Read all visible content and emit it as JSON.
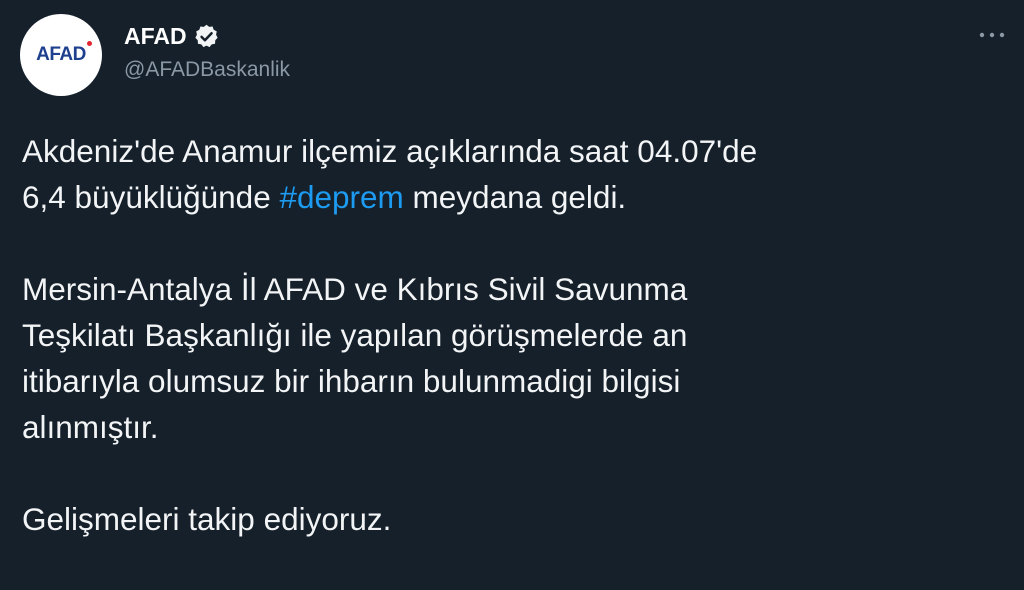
{
  "author": {
    "display_name": "AFAD",
    "handle": "@AFADBaskanlik",
    "avatar_text": "AFAD",
    "verified": true
  },
  "tweet": {
    "line1": "Akdeniz'de Anamur ilçemiz açıklarında saat 04.07'de",
    "line2_before": "6,4 büyüklüğünde ",
    "hashtag": "#deprem",
    "line2_after": " meydana geldi.",
    "paragraph2": [
      "Mersin-Antalya İl AFAD ve Kıbrıs Sivil Savunma",
      "Teşkilatı Başkanlığı ile yapılan görüşmelerde an",
      "itibarıyla olumsuz bir ihbarın bulunmadigi bilgisi",
      "alınmıştır."
    ],
    "paragraph3": "Gelişmeleri takip ediyoruz."
  },
  "icons": {
    "verified": "verified-badge-icon",
    "more": "more-options-icon"
  },
  "colors": {
    "background": "#15202b",
    "text": "#f2f4f5",
    "secondary_text": "#8b98a5",
    "link": "#1d9bf0",
    "brand_blue": "#1f3f8f",
    "brand_red": "#e3262f"
  }
}
